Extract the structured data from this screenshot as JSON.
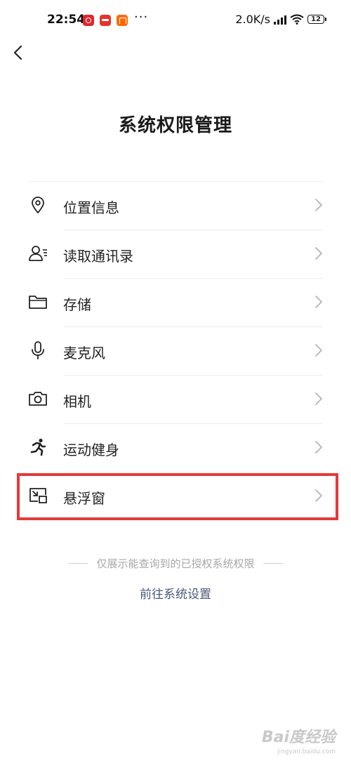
{
  "status_bar": {
    "time": "22:54",
    "dots": "···",
    "net_speed": "2.0K/s",
    "battery": "12",
    "app_icons": [
      "netease-music-icon",
      "shopping-app-icon",
      "mi-app-icon"
    ]
  },
  "header": {
    "back_icon": "chevron-left-icon",
    "title": "系统权限管理"
  },
  "permissions": [
    {
      "label": "位置信息",
      "icon": "location-pin-icon"
    },
    {
      "label": "读取通讯录",
      "icon": "contacts-icon"
    },
    {
      "label": "存储",
      "icon": "folder-icon"
    },
    {
      "label": "麦克风",
      "icon": "microphone-icon"
    },
    {
      "label": "相机",
      "icon": "camera-icon"
    },
    {
      "label": "运动健身",
      "icon": "running-icon"
    },
    {
      "label": "悬浮窗",
      "icon": "floating-window-icon"
    }
  ],
  "footer": {
    "note": "仅展示能查询到的已授权系统权限",
    "settings_link": "前往系统设置"
  },
  "watermark": {
    "logo": "Bai度经验",
    "sub": "jingyan.baidu.com"
  },
  "colors": {
    "highlight": "#e33a3a",
    "link": "#4a5a7a",
    "muted": "#a8a8a8"
  }
}
